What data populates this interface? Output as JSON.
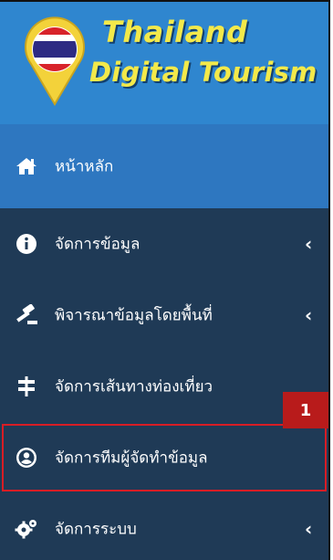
{
  "logo": {
    "line1": "Thailand",
    "line2": "Digital Tourism"
  },
  "menu": {
    "items": [
      {
        "label": "หน้าหลัก",
        "icon": "home-icon",
        "has_submenu": false
      },
      {
        "label": "จัดการข้อมูล",
        "icon": "info-icon",
        "has_submenu": true
      },
      {
        "label": "พิจารณาข้อมูลโดยพื้นที่",
        "icon": "gavel-icon",
        "has_submenu": true
      },
      {
        "label": "จัดการเส้นทางท่องเที่ยว",
        "icon": "signpost-icon",
        "has_submenu": false
      },
      {
        "label": "จัดการทีมผู้จัดทำข้อมูล",
        "icon": "user-circle-icon",
        "has_submenu": false
      },
      {
        "label": "จัดการระบบ",
        "icon": "cogs-icon",
        "has_submenu": true
      }
    ]
  },
  "annotation": {
    "badge_number": "1"
  },
  "colors": {
    "header": "#2f86cf",
    "sidebar": "#1f3a56",
    "active_item": "#2e77c0",
    "logo_text": "#f3e94a",
    "highlight": "#d81d25"
  }
}
